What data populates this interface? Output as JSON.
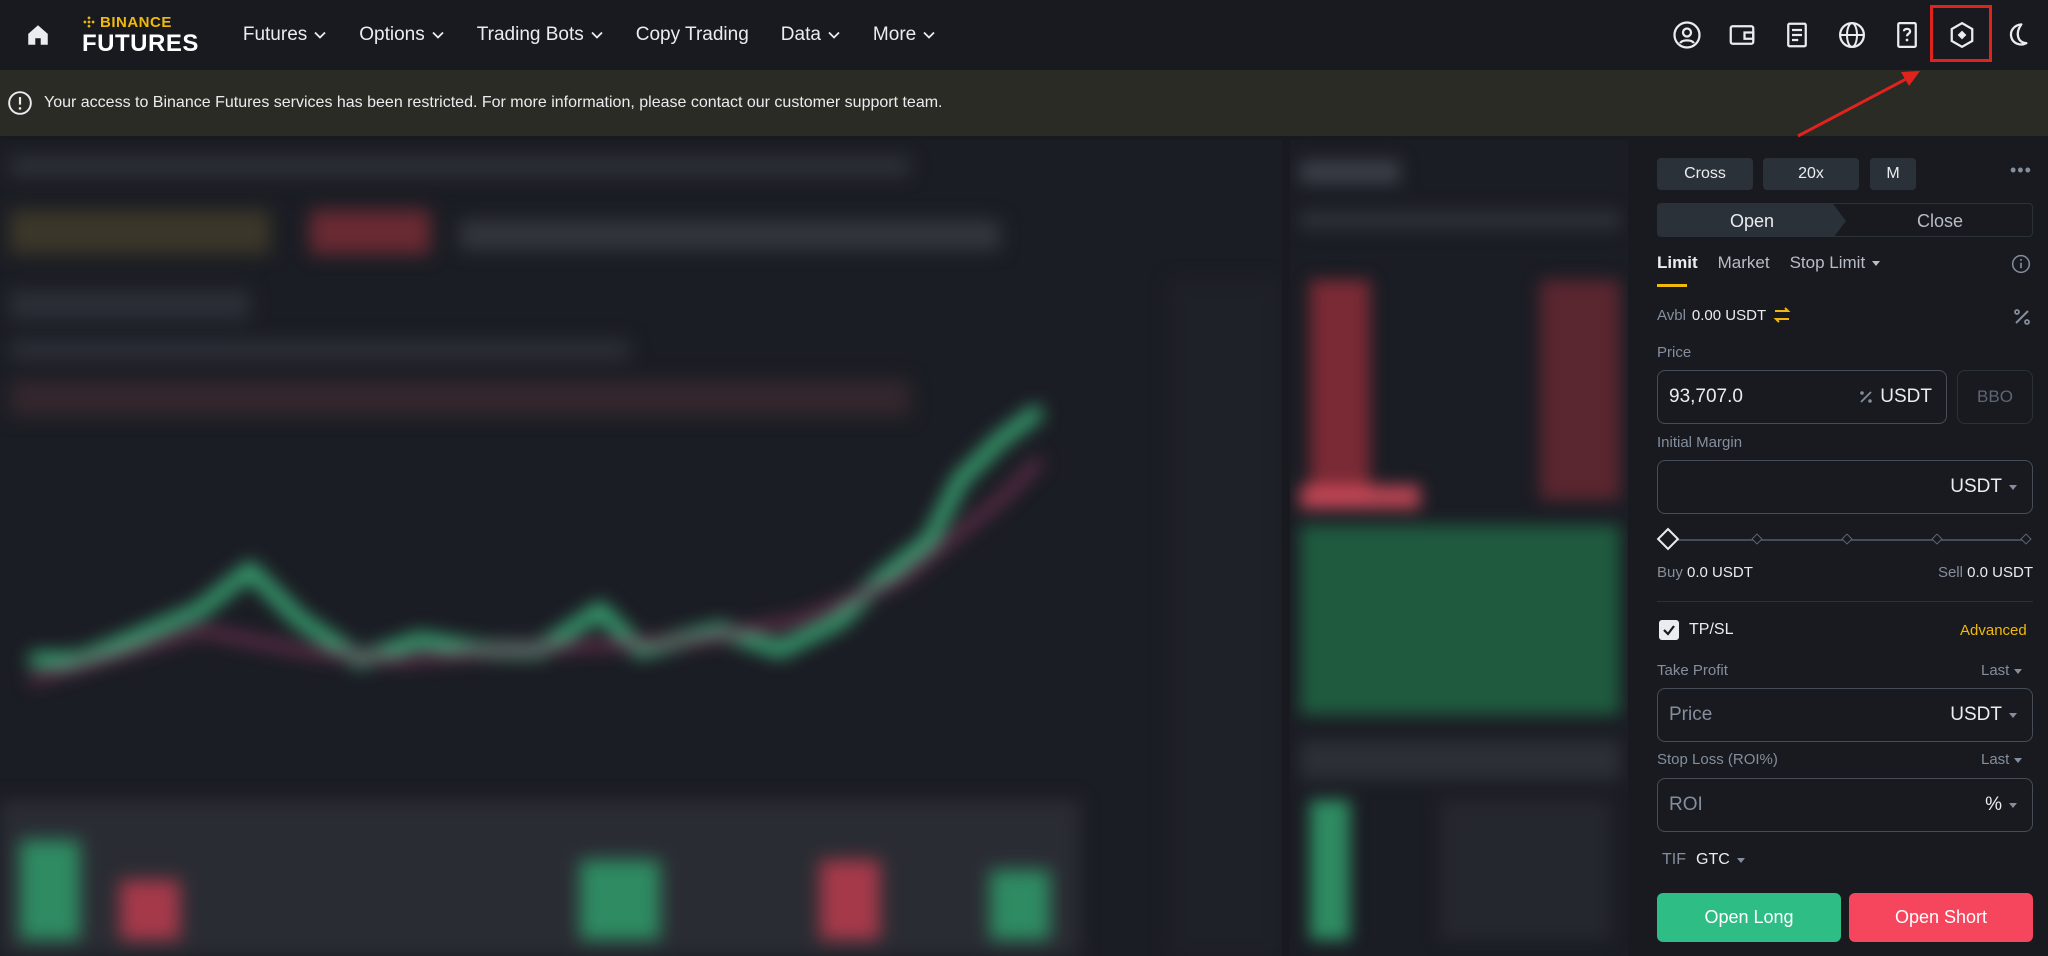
{
  "brand": {
    "top": "BINANCE",
    "bottom": "FUTURES"
  },
  "nav": [
    {
      "label": "Futures",
      "has_menu": true
    },
    {
      "label": "Options",
      "has_menu": true
    },
    {
      "label": "Trading Bots",
      "has_menu": true
    },
    {
      "label": "Copy Trading",
      "has_menu": false
    },
    {
      "label": "Data",
      "has_menu": true
    },
    {
      "label": "More",
      "has_menu": true
    }
  ],
  "header_icons": [
    "user-icon",
    "wallet-icon",
    "orders-icon",
    "globe-icon",
    "help-icon",
    "settings-icon",
    "moon-icon"
  ],
  "banner": {
    "text": "Your access to Binance Futures services has been restricted. For more information, please contact our customer support team."
  },
  "order_panel": {
    "margin_mode": "Cross",
    "leverage": "20x",
    "asset_mode": "M",
    "side_tabs": {
      "open": "Open",
      "close": "Close"
    },
    "order_types": [
      "Limit",
      "Market",
      "Stop Limit"
    ],
    "avbl_label": "Avbl",
    "avbl_value": "0.00 USDT",
    "price_label": "Price",
    "price_value": "93,707.0",
    "price_unit": "USDT",
    "bbo_label": "BBO",
    "margin_label": "Initial Margin",
    "margin_unit": "USDT",
    "buy_label": "Buy",
    "buy_value": "0.0 USDT",
    "sell_label": "Sell",
    "sell_value": "0.0 USDT",
    "tpsl_label": "TP/SL",
    "tpsl_checked": true,
    "advanced_label": "Advanced",
    "take_profit_label": "Take Profit",
    "take_profit_trigger": "Last",
    "take_profit_placeholder": "Price",
    "take_profit_unit": "USDT",
    "stop_loss_label": "Stop Loss (ROI%)",
    "stop_loss_trigger": "Last",
    "stop_loss_placeholder": "ROI",
    "stop_loss_unit": "%",
    "tif_label": "TIF",
    "tif_value": "GTC",
    "open_long_label": "Open Long",
    "open_short_label": "Open Short"
  },
  "colors": {
    "accent": "#f0b90b",
    "long": "#2ebd85",
    "short": "#f6465d",
    "annotation": "#e0231d",
    "banner_bg": "#2b2b25"
  }
}
